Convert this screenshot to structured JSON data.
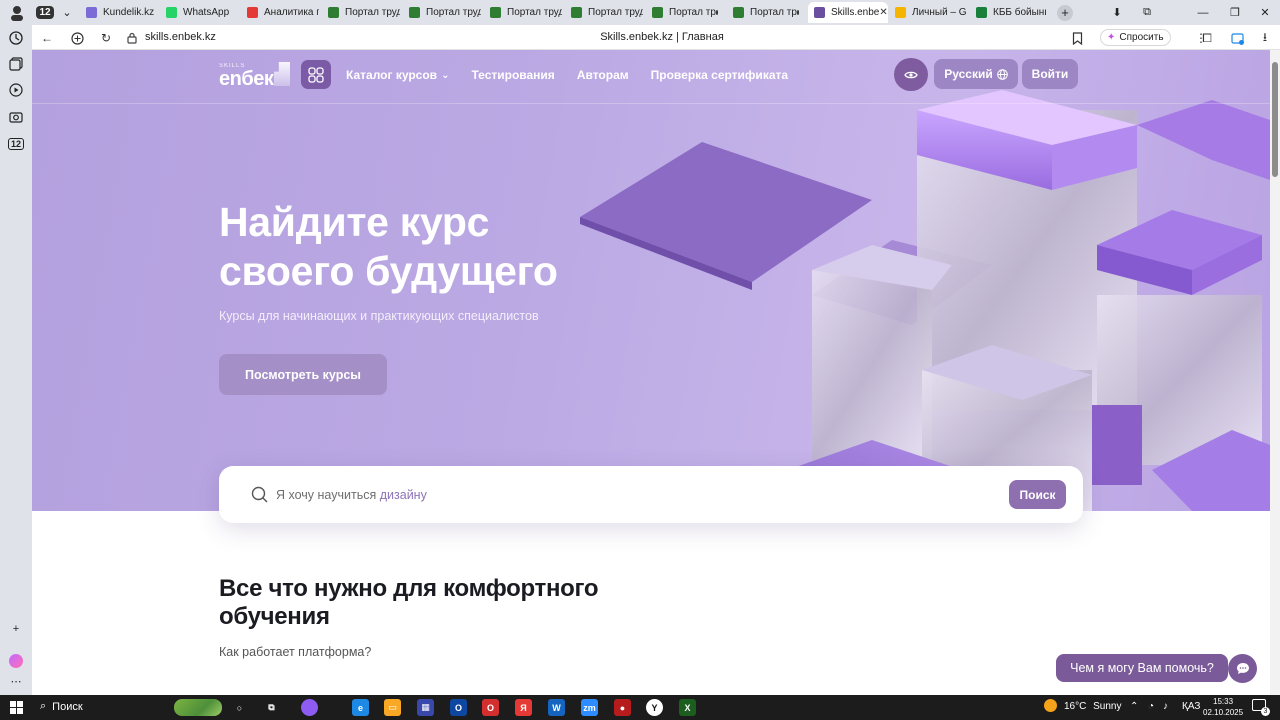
{
  "browser": {
    "tabs": [
      {
        "label": "Kundelik.kz",
        "fav": "#7a6bd6"
      },
      {
        "label": "WhatsApp",
        "fav": "#25d366"
      },
      {
        "label": "Аналитика п",
        "fav": "#e53935"
      },
      {
        "label": "Портал труд",
        "fav": "#2e7d32"
      },
      {
        "label": "Портал труд",
        "fav": "#2e7d32"
      },
      {
        "label": "Портал труд",
        "fav": "#2e7d32"
      },
      {
        "label": "Портал труд",
        "fav": "#2e7d32"
      },
      {
        "label": "Портал тр",
        "fav": "#2e7d32"
      },
      {
        "label": "Портал тр",
        "fav": "#2e7d32"
      },
      {
        "label": "Skills.enbe",
        "fav": "#6b4ea0"
      },
      {
        "label": "Личный – Gc",
        "fav": "#f4b400"
      },
      {
        "label": "КББ бойынш",
        "fav": "#188038"
      }
    ],
    "tab_count_badge": "12",
    "url": "skills.enbek.kz",
    "page_title": "Skills.enbek.kz | Главная",
    "ask_label": "Спросить",
    "sidebar_badge": "12"
  },
  "nav": {
    "logo_small": "SKILLS",
    "logo_big": "enбек",
    "links": [
      "Каталог курсов",
      "Тестирования",
      "Авторам",
      "Проверка сертификата"
    ],
    "language": "Русский",
    "login": "Войти"
  },
  "hero": {
    "title": "Найдите курс своего будущего",
    "subtitle": "Курсы для начинающих и практикующих специалистов",
    "cta": "Посмотреть курсы"
  },
  "search": {
    "placeholder_prefix": "Я хочу научиться",
    "placeholder_accent": "дизайну",
    "button": "Поиск"
  },
  "section": {
    "title": "Все что нужно для комфортного обучения",
    "subtitle": "Как работает платформа?"
  },
  "help": {
    "label": "Чем я могу Вам помочь?"
  },
  "taskbar": {
    "search": "Поиск",
    "weather_temp": "16°C",
    "weather_text": "Sunny",
    "lang": "ҚАЗ",
    "time": "15:33",
    "date": "02.10.2025",
    "notif_count": "3",
    "apps": [
      {
        "name": "edge",
        "color": "#1e88e5",
        "glyph": "e"
      },
      {
        "name": "explorer",
        "color": "#f9a825",
        "glyph": "▭"
      },
      {
        "name": "store",
        "color": "#3949ab",
        "glyph": "▦"
      },
      {
        "name": "outlook",
        "color": "#0d47a1",
        "glyph": "O"
      },
      {
        "name": "opera",
        "color": "#d32f2f",
        "glyph": "O"
      },
      {
        "name": "yandex",
        "color": "#e53935",
        "glyph": "Я"
      },
      {
        "name": "word",
        "color": "#1565c0",
        "glyph": "W"
      },
      {
        "name": "zoom",
        "color": "#2d8cff",
        "glyph": "zm"
      },
      {
        "name": "recorder",
        "color": "#b71c1c",
        "glyph": "●"
      },
      {
        "name": "yandex-browser",
        "color": "#ffffff",
        "glyph": "Y"
      },
      {
        "name": "excel",
        "color": "#1b5e20",
        "glyph": "X"
      }
    ]
  },
  "colors": {
    "brand_purple": "#7b5aa6",
    "hero_bg": "#bba9e4",
    "search_button": "#8e6fb0"
  }
}
